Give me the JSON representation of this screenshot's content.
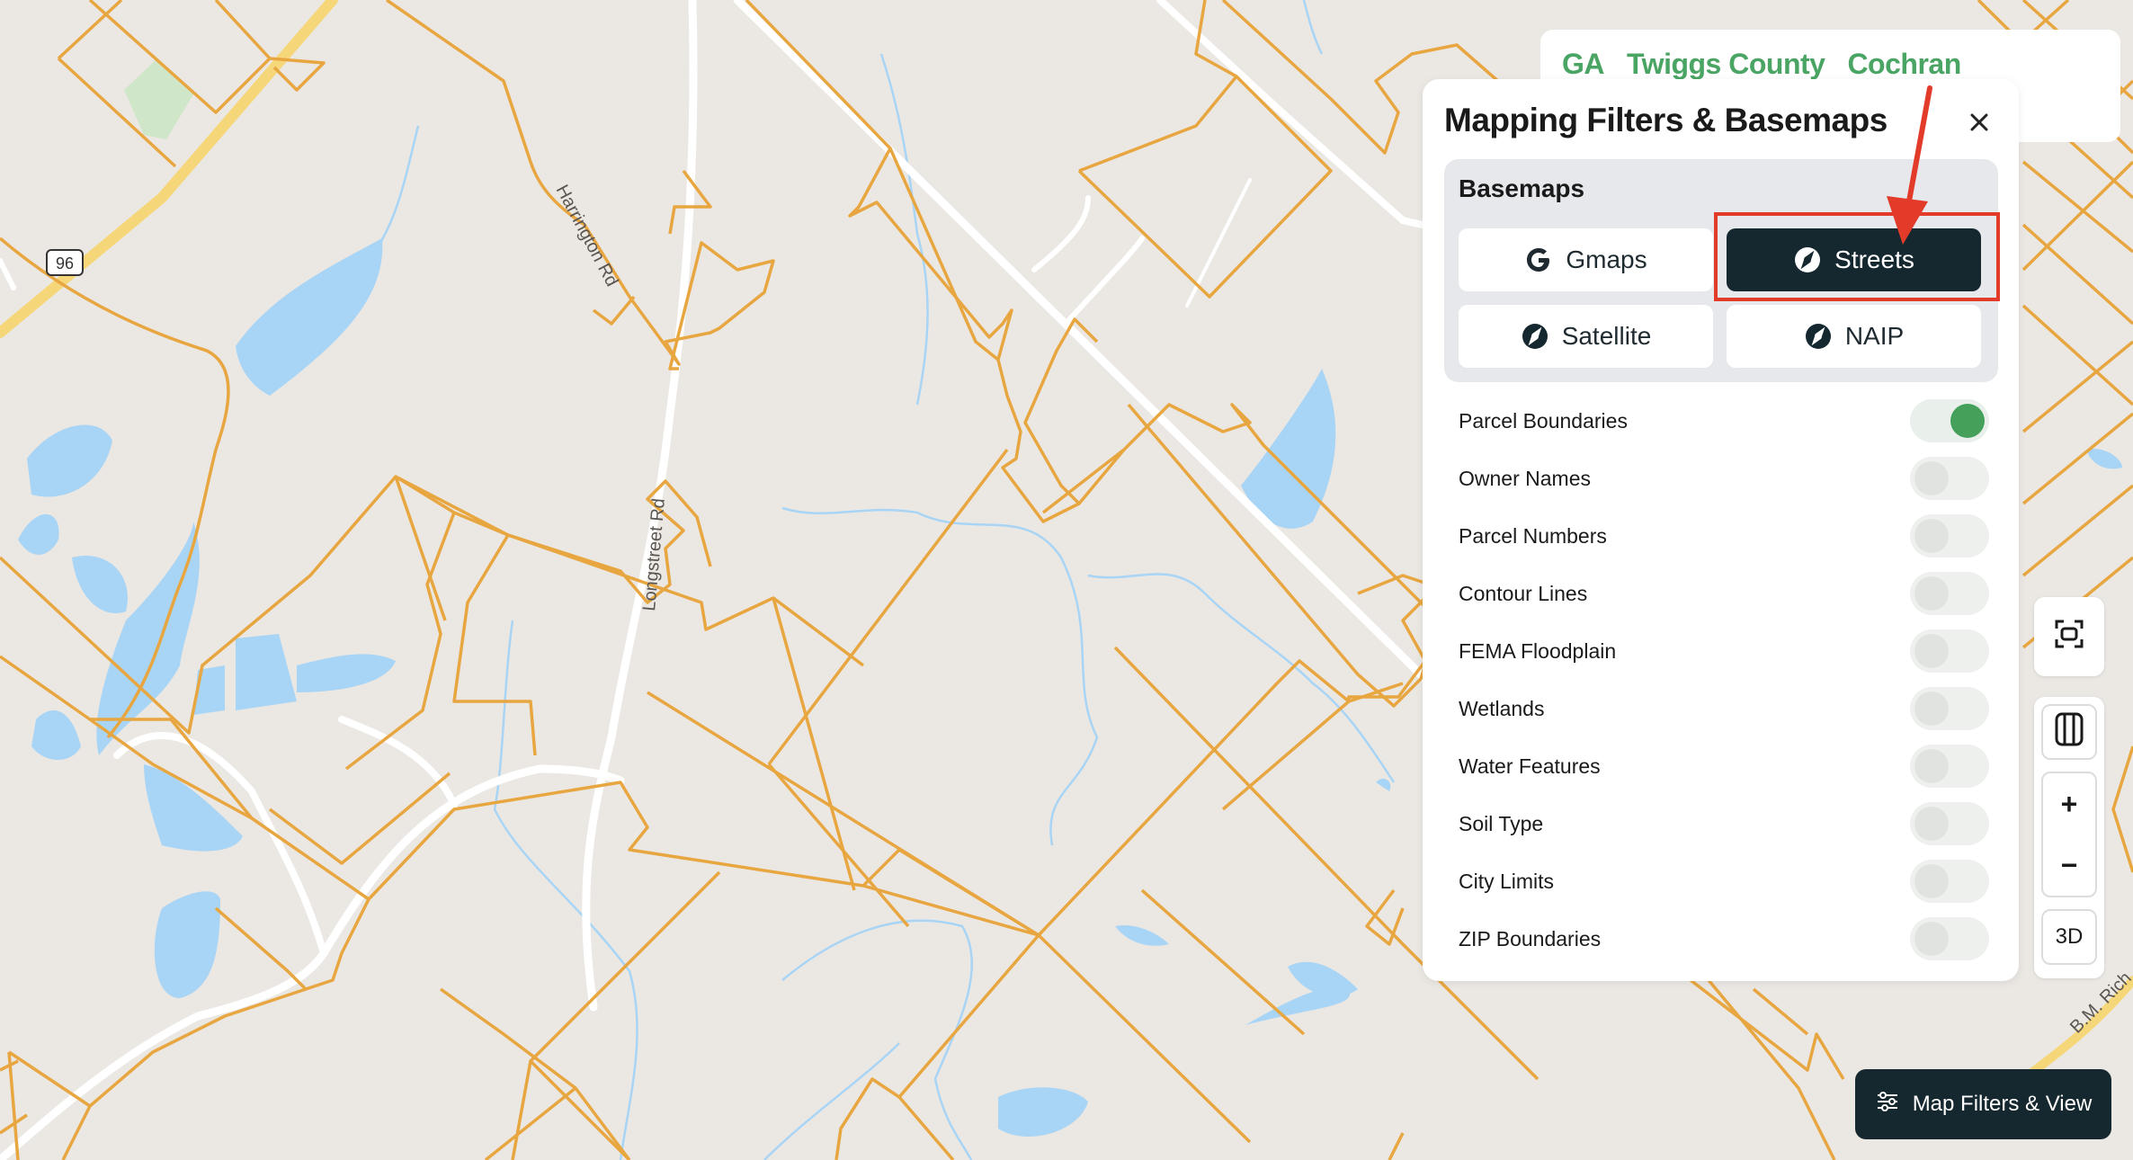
{
  "map": {
    "road_labels": [
      "Harrington Rd",
      "Longstreet Rd",
      "B.M. Rich"
    ],
    "route_shield": "96"
  },
  "breadcrumb": [
    "GA",
    "Twiggs County",
    "Cochran"
  ],
  "panel": {
    "title": "Mapping Filters & Basemaps",
    "close_icon": "close-icon",
    "basemaps": {
      "title": "Basemaps",
      "options": [
        {
          "label": "Gmaps",
          "icon": "google-icon",
          "active": false
        },
        {
          "label": "Streets",
          "icon": "compass-icon",
          "active": true
        },
        {
          "label": "Satellite",
          "icon": "compass-icon",
          "active": false
        },
        {
          "label": "NAIP",
          "icon": "compass-icon",
          "active": false
        }
      ]
    },
    "layers": [
      {
        "label": "Parcel Boundaries",
        "on": true
      },
      {
        "label": "Owner Names",
        "on": false
      },
      {
        "label": "Parcel Numbers",
        "on": false
      },
      {
        "label": "Contour Lines",
        "on": false
      },
      {
        "label": "FEMA Floodplain",
        "on": false
      },
      {
        "label": "Wetlands",
        "on": false
      },
      {
        "label": "Water Features",
        "on": false
      },
      {
        "label": "Soil Type",
        "on": false
      },
      {
        "label": "City Limits",
        "on": false
      },
      {
        "label": "ZIP Boundaries",
        "on": false
      }
    ]
  },
  "controls": {
    "zoom_in": "+",
    "zoom_out": "−",
    "three_d": "3D"
  },
  "filters_view_button": "Map Filters & View",
  "colors": {
    "accent_green": "#45a05a",
    "dark": "#16282f",
    "parcel_line": "#e8a640",
    "water": "#a8d4f5",
    "highlight": "#e33b2a"
  }
}
